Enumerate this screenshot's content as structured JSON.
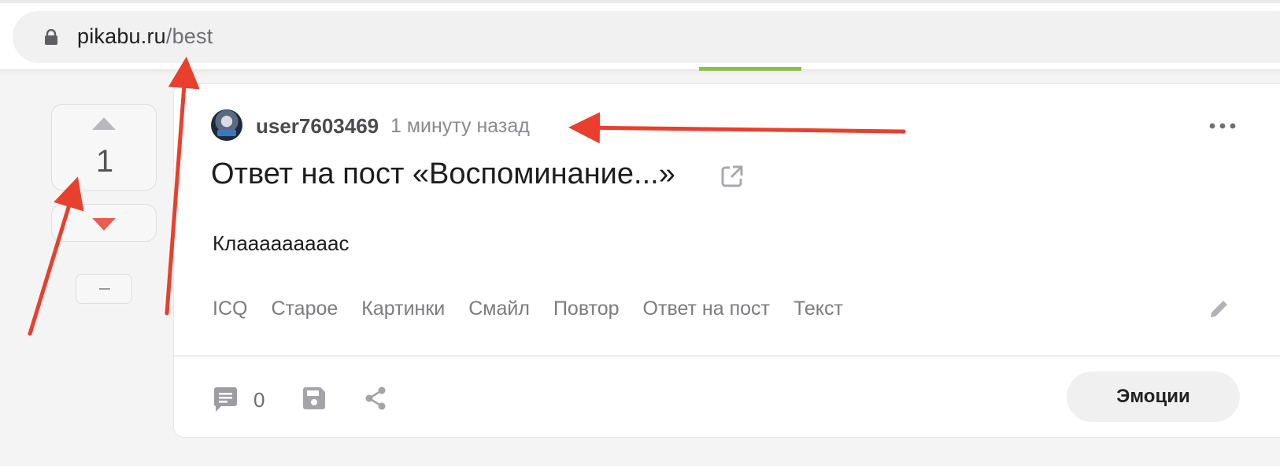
{
  "browser": {
    "url_domain": "pikabu.ru",
    "url_path": "/best",
    "accent": "#8bc34a"
  },
  "vote": {
    "count": "1",
    "up_color": "#b9b9bd",
    "down_color": "#e8604c"
  },
  "post": {
    "username": "user7603469",
    "time": "1 минуту назад",
    "title": "Ответ на пост «Воспоминание...»",
    "text": "Клааааааааас",
    "tags": [
      "ICQ",
      "Старое",
      "Картинки",
      "Смайл",
      "Повтор",
      "Ответ на пост",
      "Текст"
    ],
    "comment_count": "0",
    "emotions_label": "Эмоции"
  },
  "icons": [
    "lock-icon",
    "upvote-icon",
    "downvote-icon",
    "minus-icon",
    "more-icon",
    "external-link-icon",
    "edit-icon",
    "comment-icon",
    "save-icon",
    "share-icon"
  ],
  "annotation_color": "#e8402c"
}
